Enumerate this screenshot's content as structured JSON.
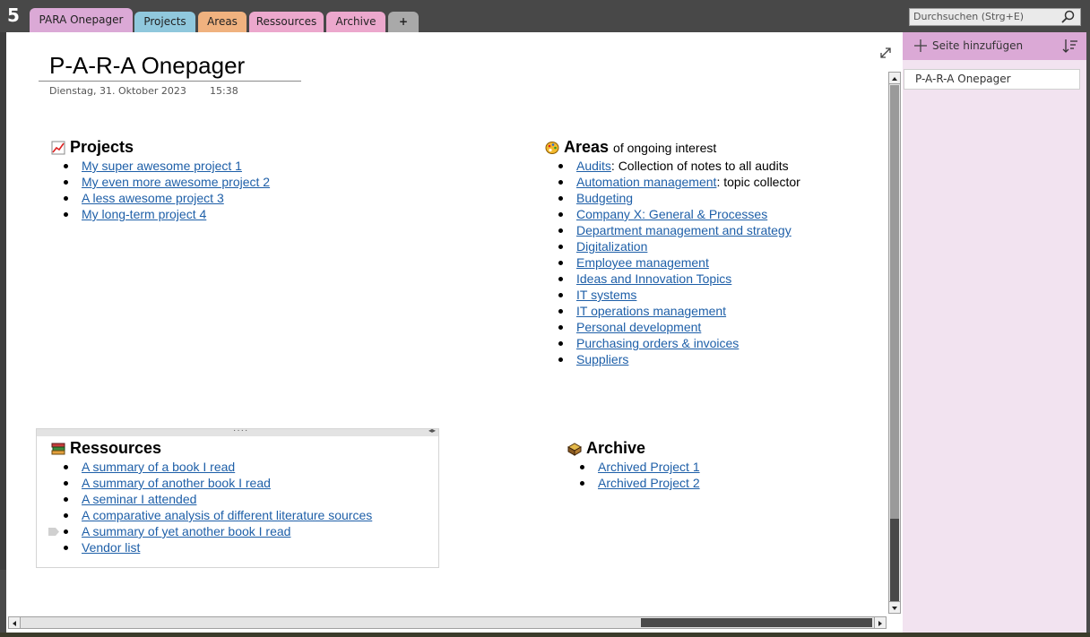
{
  "app": {
    "logo": "5",
    "logo_icon": "onenote-icon"
  },
  "tabs": [
    {
      "label": "PARA Onepager",
      "color": "#dba9d6",
      "active": true
    },
    {
      "label": "Projects",
      "color": "#90c8dd",
      "active": false
    },
    {
      "label": "Areas",
      "color": "#f0b27f",
      "active": false
    },
    {
      "label": "Ressources",
      "color": "#eca8cd",
      "active": false
    },
    {
      "label": "Archive",
      "color": "#eca8cd",
      "active": false
    },
    {
      "label": "+",
      "color": "#a9a9a9",
      "active": false
    }
  ],
  "search": {
    "placeholder": "Durchsuchen (Strg+E)",
    "icon": "search-icon"
  },
  "sidebar": {
    "add_page_label": "Seite hinzufügen",
    "add_icon": "plus-icon",
    "sort_icon": "sort-icon",
    "pages": [
      "P-A-R-A Onepager"
    ]
  },
  "page": {
    "title": "P-A-R-A Onepager",
    "date": "Dienstag, 31. Oktober 2023",
    "time": "15:38"
  },
  "projects": {
    "heading": "Projects",
    "icon": "chart-icon",
    "items": [
      "My super awesome project 1",
      "My even more awesome project 2",
      "A less awesome project 3",
      "My long-term project 4"
    ]
  },
  "areas": {
    "heading": "Areas",
    "heading_suffix": "of ongoing interest",
    "icon": "palette-icon",
    "items": [
      {
        "link": "Audits",
        "note": ": Collection of notes to all audits"
      },
      {
        "link": "Automation management",
        "note": ": topic collector"
      },
      {
        "link": "Budgeting",
        "note": ""
      },
      {
        "link": "Company X: General & Processes",
        "note": ""
      },
      {
        "link": "Department management and strategy",
        "note": ""
      },
      {
        "link": "Digitalization",
        "note": ""
      },
      {
        "link": "Employee management",
        "note": ""
      },
      {
        "link": "Ideas and Innovation Topics",
        "note": ""
      },
      {
        "link": "IT systems",
        "note": ""
      },
      {
        "link": "IT operations management",
        "note": ""
      },
      {
        "link": "Personal development",
        "note": ""
      },
      {
        "link": "Purchasing orders & invoices",
        "note": ""
      },
      {
        "link": "Suppliers",
        "note": ""
      }
    ]
  },
  "ressources": {
    "heading": "Ressources",
    "icon": "books-icon",
    "items": [
      "A summary of a book I read",
      "A summary of another book I read",
      "A seminar I attended",
      "A comparative analysis of different literature sources",
      "A summary of yet another book I read",
      "Vendor list"
    ]
  },
  "archive": {
    "heading": "Archive",
    "icon": "archive-box-icon",
    "items": [
      "Archived Project 1",
      "Archived Project 2"
    ]
  },
  "colors": {
    "link": "#1e5fa8",
    "section_active": "#dba9d6",
    "sidebar_bg": "#f2e3f0"
  }
}
